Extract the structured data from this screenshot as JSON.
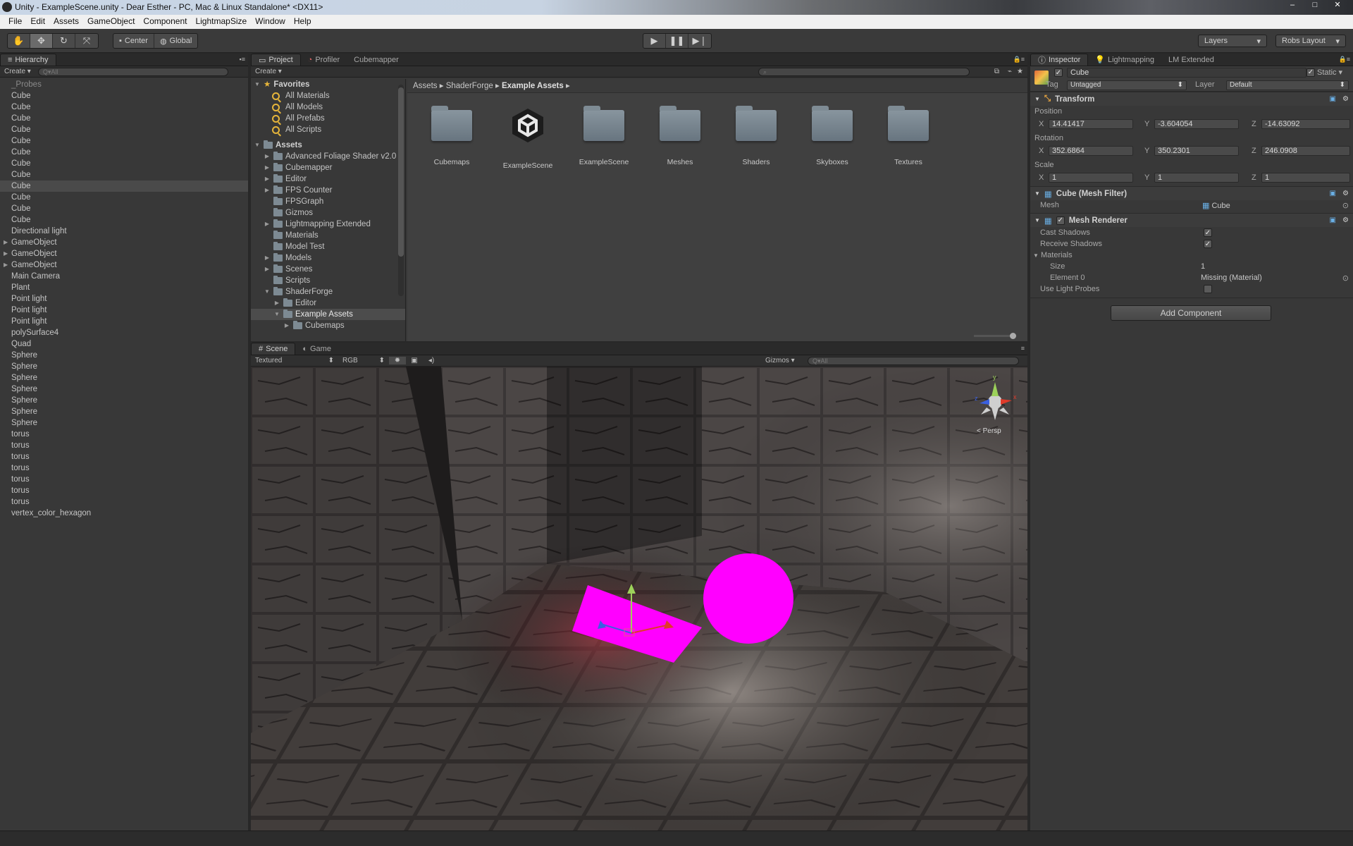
{
  "window": {
    "title": "Unity - ExampleScene.unity - Dear Esther - PC, Mac & Linux Standalone* <DX11>",
    "buttons": [
      "–",
      "□",
      "✕"
    ]
  },
  "menu": [
    "File",
    "Edit",
    "Assets",
    "GameObject",
    "Component",
    "LightmapSize",
    "Window",
    "Help"
  ],
  "toolbar": {
    "pivot_label": "Center",
    "space_label": "Global",
    "layers_label": "Layers",
    "layout_label": "Robs Layout"
  },
  "hierarchy": {
    "tab": "Hierarchy",
    "create_label": "Create",
    "search_placeholder": "Q▾All",
    "items": [
      {
        "label": "_Probes",
        "dim": true
      },
      {
        "label": "Cube"
      },
      {
        "label": "Cube"
      },
      {
        "label": "Cube"
      },
      {
        "label": "Cube"
      },
      {
        "label": "Cube"
      },
      {
        "label": "Cube"
      },
      {
        "label": "Cube"
      },
      {
        "label": "Cube"
      },
      {
        "label": "Cube",
        "selected": true
      },
      {
        "label": "Cube"
      },
      {
        "label": "Cube"
      },
      {
        "label": "Cube"
      },
      {
        "label": "Directional light"
      },
      {
        "label": "GameObject",
        "expandable": true
      },
      {
        "label": "GameObject",
        "expandable": true
      },
      {
        "label": "GameObject",
        "expandable": true
      },
      {
        "label": "Main Camera"
      },
      {
        "label": "Plant"
      },
      {
        "label": "Point light"
      },
      {
        "label": "Point light"
      },
      {
        "label": "Point light"
      },
      {
        "label": "polySurface4"
      },
      {
        "label": "Quad"
      },
      {
        "label": "Sphere"
      },
      {
        "label": "Sphere"
      },
      {
        "label": "Sphere"
      },
      {
        "label": "Sphere"
      },
      {
        "label": "Sphere"
      },
      {
        "label": "Sphere"
      },
      {
        "label": "Sphere"
      },
      {
        "label": "torus"
      },
      {
        "label": "torus"
      },
      {
        "label": "torus"
      },
      {
        "label": "torus"
      },
      {
        "label": "torus"
      },
      {
        "label": "torus"
      },
      {
        "label": "torus"
      },
      {
        "label": "vertex_color_hexagon"
      }
    ]
  },
  "project": {
    "tabs": [
      "Project",
      "Profiler",
      "Cubemapper"
    ],
    "create_label": "Create",
    "favorites_label": "Favorites",
    "favorites": [
      "All Materials",
      "All Models",
      "All Prefabs",
      "All Scripts"
    ],
    "assets_label": "Assets",
    "tree": [
      {
        "label": "Advanced Foliage Shader v2.0",
        "depth": 1,
        "arrow": "▶"
      },
      {
        "label": "Cubemapper",
        "depth": 1,
        "arrow": "▶"
      },
      {
        "label": "Editor",
        "depth": 1,
        "arrow": "▶"
      },
      {
        "label": "FPS Counter",
        "depth": 1,
        "arrow": "▶"
      },
      {
        "label": "FPSGraph",
        "depth": 1,
        "arrow": ""
      },
      {
        "label": "Gizmos",
        "depth": 1,
        "arrow": ""
      },
      {
        "label": "Lightmapping Extended",
        "depth": 1,
        "arrow": "▶"
      },
      {
        "label": "Materials",
        "depth": 1,
        "arrow": ""
      },
      {
        "label": "Model Test",
        "depth": 1,
        "arrow": ""
      },
      {
        "label": "Models",
        "depth": 1,
        "arrow": "▶"
      },
      {
        "label": "Scenes",
        "depth": 1,
        "arrow": "▶"
      },
      {
        "label": "Scripts",
        "depth": 1,
        "arrow": ""
      },
      {
        "label": "ShaderForge",
        "depth": 1,
        "arrow": "▼"
      },
      {
        "label": "Editor",
        "depth": 2,
        "arrow": "▶"
      },
      {
        "label": "Example Assets",
        "depth": 2,
        "arrow": "▼",
        "selected": true
      },
      {
        "label": "Cubemaps",
        "depth": 3,
        "arrow": "▶"
      }
    ],
    "breadcrumb": [
      "Assets",
      "ShaderForge",
      "Example Assets"
    ],
    "assets": [
      {
        "label": "Cubemaps",
        "kind": "folder"
      },
      {
        "label": "ExampleScene",
        "kind": "unity-scene"
      },
      {
        "label": "ExampleScene",
        "kind": "folder"
      },
      {
        "label": "Meshes",
        "kind": "folder"
      },
      {
        "label": "Shaders",
        "kind": "folder"
      },
      {
        "label": "Skyboxes",
        "kind": "folder"
      },
      {
        "label": "Textures",
        "kind": "folder"
      }
    ]
  },
  "scene": {
    "tabs": [
      "Scene",
      "Game"
    ],
    "render_mode": "Textured",
    "color_mode": "RGB",
    "gizmos_label": "Gizmos",
    "search_placeholder": "Q▾All",
    "persp_label": "< Persp",
    "magenta": "#ff00ff"
  },
  "inspector": {
    "tabs": [
      "Inspector",
      "Lightmapping",
      "LM Extended"
    ],
    "object_name": "Cube",
    "static_label": "Static",
    "tag_label": "Tag",
    "tag_value": "Untagged",
    "layer_label": "Layer",
    "layer_value": "Default",
    "transform": {
      "title": "Transform",
      "position_label": "Position",
      "rotation_label": "Rotation",
      "scale_label": "Scale",
      "position": [
        "14.41417",
        "-3.604054",
        "-14.63092"
      ],
      "rotation": [
        "352.6864",
        "350.2301",
        "246.0908"
      ],
      "scale": [
        "1",
        "1",
        "1"
      ]
    },
    "mesh_filter": {
      "title": "Cube (Mesh Filter)",
      "mesh_label": "Mesh",
      "mesh_value": "Cube"
    },
    "mesh_renderer": {
      "title": "Mesh Renderer",
      "cast_shadows": "Cast Shadows",
      "receive_shadows": "Receive Shadows",
      "materials": "Materials",
      "size_label": "Size",
      "size_value": "1",
      "element_label": "Element 0",
      "element_value": "Missing (Material)",
      "light_probes": "Use Light Probes"
    },
    "add_component": "Add Component"
  }
}
